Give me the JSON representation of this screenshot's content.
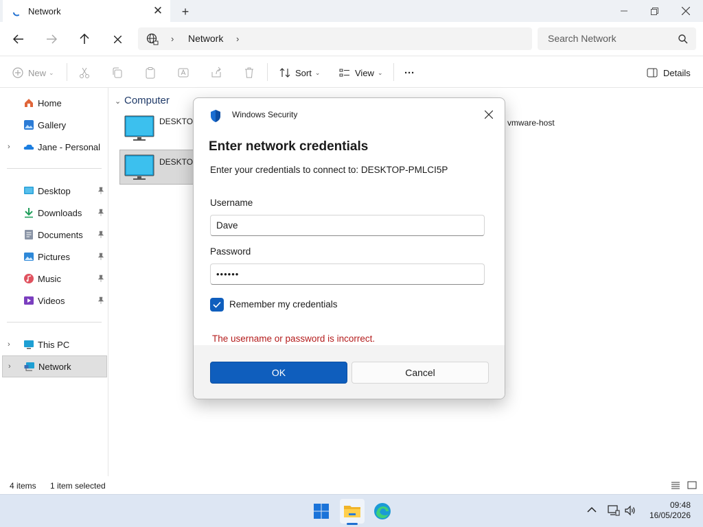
{
  "window": {
    "tab_title": "Network",
    "new_tab": "+"
  },
  "address": {
    "crumb": "Network",
    "search_placeholder": "Search Network"
  },
  "toolbar": {
    "new_label": "New",
    "sort_label": "Sort",
    "view_label": "View",
    "more_label": "···",
    "details_label": "Details"
  },
  "sidebar": {
    "items": [
      {
        "label": "Home",
        "icon": "home-icon"
      },
      {
        "label": "Gallery",
        "icon": "gallery-icon"
      },
      {
        "label": "Jane - Personal",
        "icon": "onedrive-icon"
      },
      {
        "label": "Desktop",
        "icon": "desktop-folder-icon"
      },
      {
        "label": "Downloads",
        "icon": "downloads-icon"
      },
      {
        "label": "Documents",
        "icon": "documents-icon"
      },
      {
        "label": "Pictures",
        "icon": "pictures-icon"
      },
      {
        "label": "Music",
        "icon": "music-icon"
      },
      {
        "label": "Videos",
        "icon": "videos-icon"
      },
      {
        "label": "This PC",
        "icon": "this-pc-icon"
      },
      {
        "label": "Network",
        "icon": "network-icon"
      }
    ]
  },
  "content": {
    "group_title": "Computer",
    "items": [
      {
        "name": "DESKTOP"
      },
      {
        "name": "DESKTOP"
      },
      {
        "name": "vmware-host"
      }
    ]
  },
  "status": {
    "count": "4 items",
    "selected": "1 item selected"
  },
  "taskbar": {
    "time": "09:48",
    "date": "16/05/2026"
  },
  "dialog": {
    "app_name": "Windows Security",
    "title": "Enter network credentials",
    "subtitle": "Enter your credentials to connect to: DESKTOP-PMLCI5P",
    "username_label": "Username",
    "username_value": "Dave",
    "password_label": "Password",
    "password_value": "••••••",
    "remember_label": "Remember my credentials",
    "remember_checked": true,
    "error": "The username or password is incorrect.",
    "ok_label": "OK",
    "cancel_label": "Cancel"
  },
  "colors": {
    "accent": "#0f5ebd",
    "error": "#b41c1c",
    "taskbar": "#dde6f3"
  }
}
